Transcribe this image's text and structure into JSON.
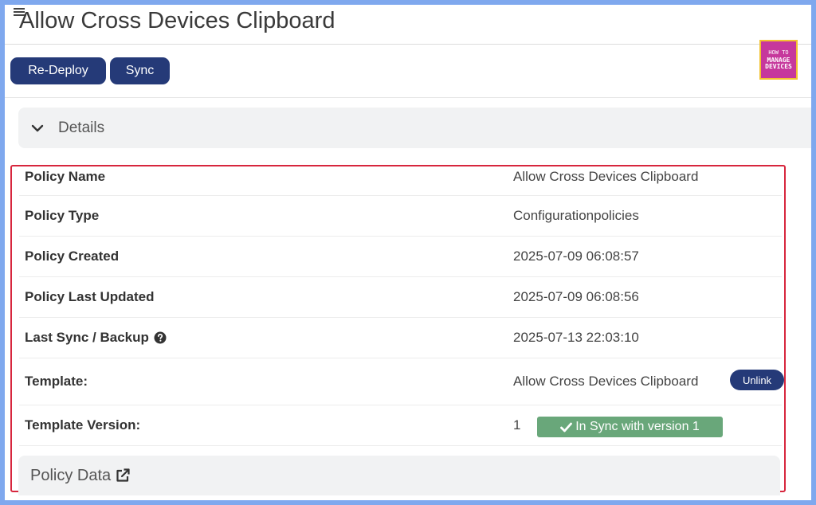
{
  "header": {
    "title": "Allow Cross Devices Clipboard"
  },
  "toolbar": {
    "redeploy_label": "Re-Deploy",
    "sync_label": "Sync"
  },
  "logo": {
    "line1": "HOW TO",
    "line2": "MANAGE",
    "line3": "DEVICES"
  },
  "details": {
    "section_label": "Details",
    "rows": [
      {
        "label": "Policy Name",
        "value": "Allow Cross Devices Clipboard"
      },
      {
        "label": "Policy Type",
        "value": "Configurationpolicies"
      },
      {
        "label": "Policy Created",
        "value": "2025-07-09 06:08:57"
      },
      {
        "label": "Policy Last Updated",
        "value": "2025-07-09 06:08:56"
      },
      {
        "label": "Last Sync / Backup",
        "value": "2025-07-13 22:03:10"
      },
      {
        "label": "Template:",
        "value": "Allow Cross Devices Clipboard",
        "action_label": "Unlink"
      },
      {
        "label": "Template Version:",
        "value": "1",
        "badge": "In Sync with version 1"
      }
    ]
  },
  "policy_data": {
    "label": "Policy Data"
  },
  "icons": {
    "menu": "hamburger-icon",
    "collapse": "chevron-down-icon",
    "help": "question-circle-icon",
    "check": "check-icon",
    "external": "external-link-icon"
  },
  "colors": {
    "primary_button": "#253a78",
    "highlight_border": "#d7263d",
    "sync_badge": "#69a77a",
    "section_bar": "#f1f2f3",
    "backdrop": "#7fa8ee"
  }
}
